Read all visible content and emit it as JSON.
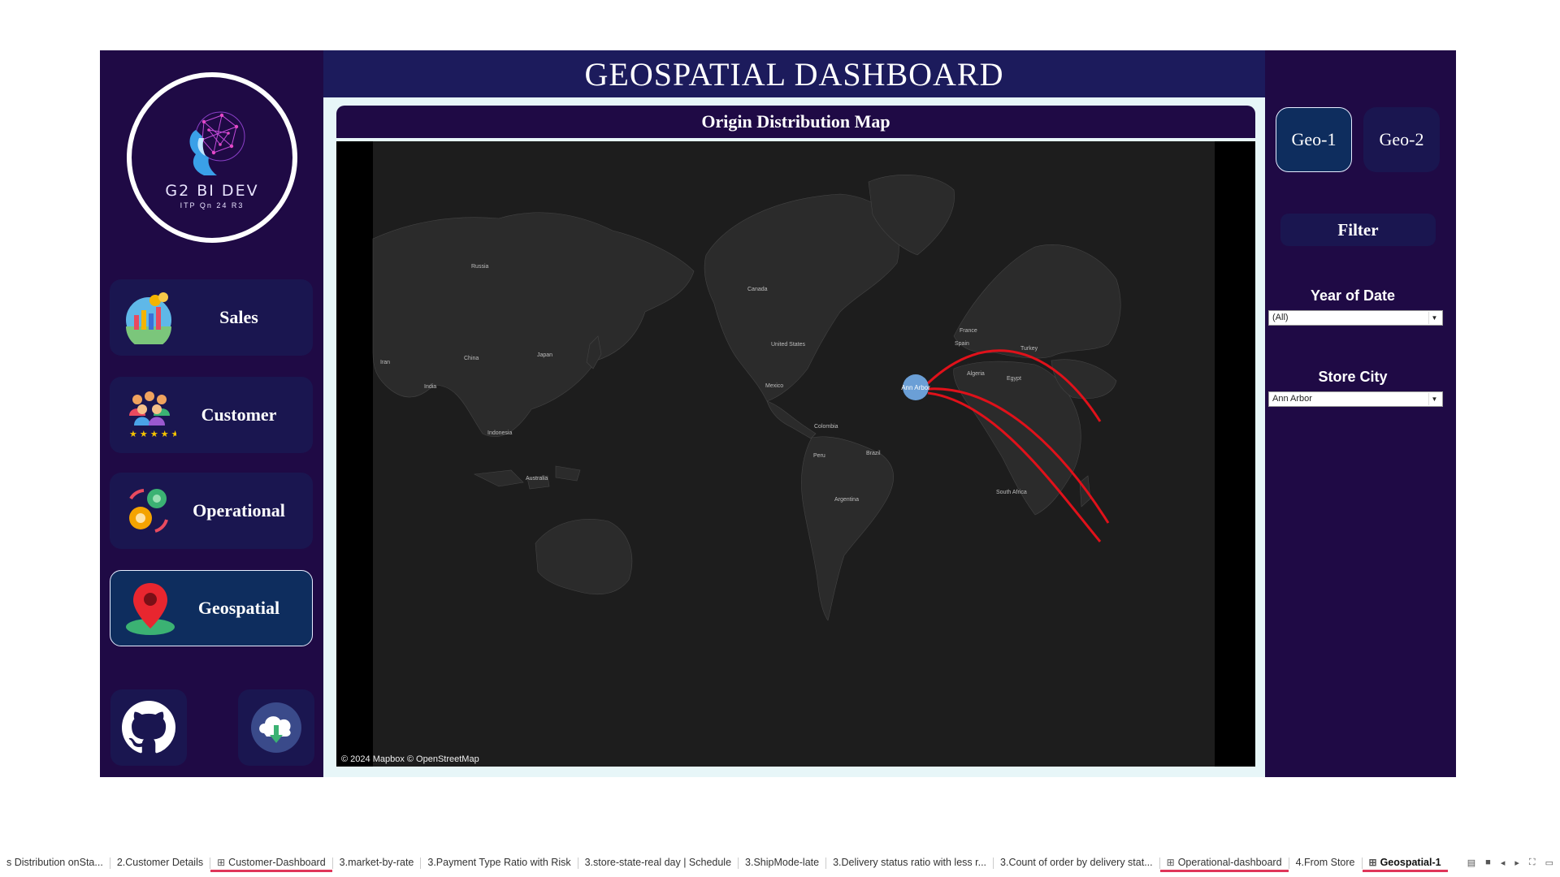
{
  "logo": {
    "name": "G2 BI DEV",
    "tagline": "ITP Qn 24 R3"
  },
  "nav": [
    {
      "label": "Sales",
      "icon": "sales-chart-icon"
    },
    {
      "label": "Customer",
      "icon": "customer-group-icon"
    },
    {
      "label": "Operational",
      "icon": "gears-icon"
    },
    {
      "label": "Geospatial",
      "icon": "map-pin-icon",
      "active": true
    }
  ],
  "links": {
    "github_icon": "github-icon",
    "download_icon": "cloud-download-icon"
  },
  "title": "GEOSPATIAL DASHBOARD",
  "map": {
    "header": "Origin Distribution Map",
    "origin_label": "Ann Arbor",
    "attribution": "© 2024 Mapbox © OpenStreetMap",
    "place_labels": [
      "Russia",
      "Canada",
      "United States",
      "Mexico",
      "China",
      "Japan",
      "India",
      "Iran",
      "Indonesia",
      "Australia",
      "Colombia",
      "Peru",
      "Brazil",
      "Argentina",
      "Spain",
      "France",
      "Turkey",
      "Algeria",
      "Egypt",
      "South Africa"
    ],
    "colors": {
      "route": "#e0111a",
      "origin": "#6b9fd6",
      "land": "#2b2b2b",
      "sea": "#1d1d1d"
    }
  },
  "geo_buttons": [
    "Geo-1",
    "Geo-2"
  ],
  "filter": {
    "title": "Filter",
    "year_label": "Year of Date",
    "year_value": "(All)",
    "city_label": "Store City",
    "city_value": "Ann Arbor"
  },
  "tabs": [
    {
      "label": "s Distribution onSta...",
      "dashboard": false
    },
    {
      "label": "2.Customer Details",
      "dashboard": false
    },
    {
      "label": "Customer-Dashboard",
      "dashboard": true
    },
    {
      "label": "3.market-by-rate",
      "dashboard": false
    },
    {
      "label": "3.Payment Type Ratio with Risk",
      "dashboard": false
    },
    {
      "label": "3.store-state-real day | Schedule",
      "dashboard": false
    },
    {
      "label": "3.ShipMode-late",
      "dashboard": false
    },
    {
      "label": "3.Delivery status ratio with less r...",
      "dashboard": false
    },
    {
      "label": "3.Count of order by delivery stat...",
      "dashboard": false
    },
    {
      "label": "Operational-dashboard",
      "dashboard": true
    },
    {
      "label": "4.From Store",
      "dashboard": false
    },
    {
      "label": "Geospatial-1",
      "dashboard": true,
      "active": true
    }
  ]
}
